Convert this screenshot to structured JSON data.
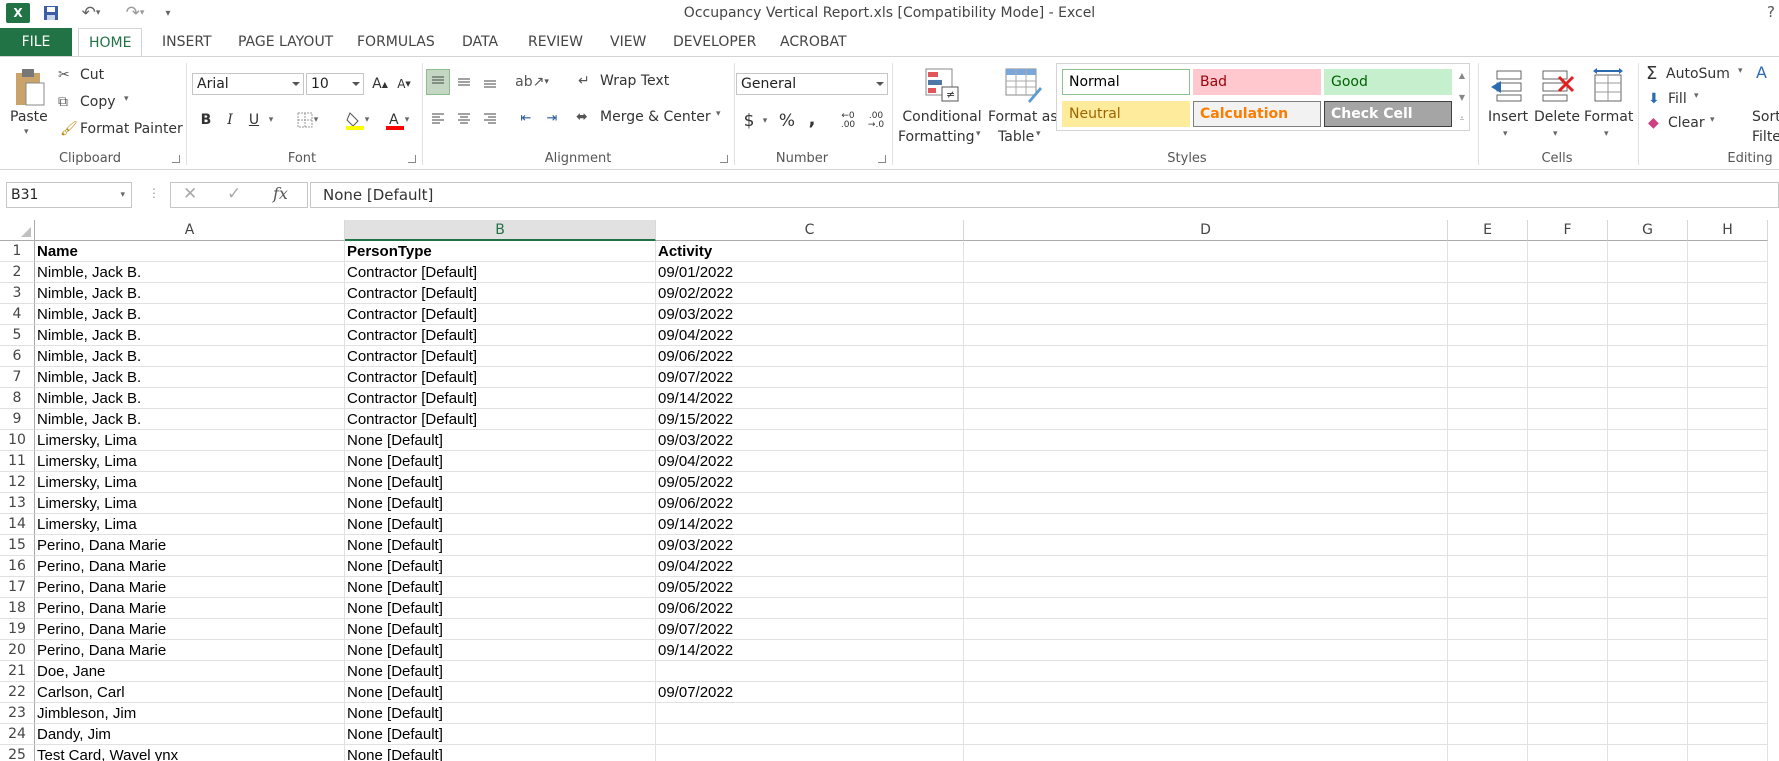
{
  "window": {
    "title": "Occupancy Vertical Report.xls  [Compatibility Mode] - Excel",
    "help": "?"
  },
  "tabs": [
    "FILE",
    "HOME",
    "INSERT",
    "PAGE LAYOUT",
    "FORMULAS",
    "DATA",
    "REVIEW",
    "VIEW",
    "DEVELOPER",
    "ACROBAT"
  ],
  "active_tab": "HOME",
  "ribbon": {
    "clipboard": {
      "paste": "Paste",
      "cut": "Cut",
      "copy": "Copy",
      "format_painter": "Format Painter",
      "label": "Clipboard"
    },
    "font": {
      "name": "Arial",
      "size": "10",
      "bold": "B",
      "italic": "I",
      "underline": "U",
      "label": "Font"
    },
    "alignment": {
      "wrap_text": "Wrap Text",
      "merge_center": "Merge & Center",
      "label": "Alignment"
    },
    "number": {
      "format": "General",
      "currency": "$",
      "percent": "%",
      "comma": ",",
      "label": "Number"
    },
    "styles": {
      "conditional": "Conditional",
      "conditional2": "Formatting",
      "format_as": "Format as",
      "format_as2": "Table",
      "label": "Styles",
      "cells": [
        {
          "name": "Normal",
          "bg": "#ffffff",
          "fg": "#000000",
          "border": "#8fc08f"
        },
        {
          "name": "Bad",
          "bg": "#ffc7ce",
          "fg": "#9c0006",
          "border": "#ffc7ce"
        },
        {
          "name": "Good",
          "bg": "#c6efce",
          "fg": "#006100",
          "border": "#c6efce"
        },
        {
          "name": "Neutral",
          "bg": "#ffeb9c",
          "fg": "#9c6500",
          "border": "#ffeb9c"
        },
        {
          "name": "Calculation",
          "bg": "#f2f2f2",
          "fg": "#fa7d00",
          "border": "#7f7f7f"
        },
        {
          "name": "Check Cell",
          "bg": "#a5a5a5",
          "fg": "#ffffff",
          "border": "#3f3f3f"
        }
      ]
    },
    "cells": {
      "insert": "Insert",
      "delete": "Delete",
      "format": "Format",
      "label": "Cells"
    },
    "editing": {
      "autosum": "AutoSum",
      "fill": "Fill",
      "clear": "Clear",
      "sort": "Sort",
      "filter": "Filte",
      "label": "Editing"
    }
  },
  "formula_bar": {
    "name_box": "B31",
    "formula": "None [Default]",
    "fx": "fx"
  },
  "columns": [
    "A",
    "B",
    "C",
    "D",
    "E",
    "F",
    "G",
    "H"
  ],
  "selected_column": "B",
  "rows": [
    [
      "1",
      "Name",
      "PersonType",
      "Activity"
    ],
    [
      "2",
      "Nimble, Jack B.",
      "Contractor [Default]",
      "09/01/2022"
    ],
    [
      "3",
      "Nimble, Jack B.",
      "Contractor [Default]",
      "09/02/2022"
    ],
    [
      "4",
      "Nimble, Jack B.",
      "Contractor [Default]",
      "09/03/2022"
    ],
    [
      "5",
      "Nimble, Jack B.",
      "Contractor [Default]",
      "09/04/2022"
    ],
    [
      "6",
      "Nimble, Jack B.",
      "Contractor [Default]",
      "09/06/2022"
    ],
    [
      "7",
      "Nimble, Jack B.",
      "Contractor [Default]",
      "09/07/2022"
    ],
    [
      "8",
      "Nimble, Jack B.",
      "Contractor [Default]",
      "09/14/2022"
    ],
    [
      "9",
      "Nimble, Jack B.",
      "Contractor [Default]",
      "09/15/2022"
    ],
    [
      "10",
      "Limersky, Lima",
      "None [Default]",
      "09/03/2022"
    ],
    [
      "11",
      "Limersky, Lima",
      "None [Default]",
      "09/04/2022"
    ],
    [
      "12",
      "Limersky, Lima",
      "None [Default]",
      "09/05/2022"
    ],
    [
      "13",
      "Limersky, Lima",
      "None [Default]",
      "09/06/2022"
    ],
    [
      "14",
      "Limersky, Lima",
      "None [Default]",
      "09/14/2022"
    ],
    [
      "15",
      "Perino, Dana Marie",
      "None [Default]",
      "09/03/2022"
    ],
    [
      "16",
      "Perino, Dana Marie",
      "None [Default]",
      "09/04/2022"
    ],
    [
      "17",
      "Perino, Dana Marie",
      "None [Default]",
      "09/05/2022"
    ],
    [
      "18",
      "Perino, Dana Marie",
      "None [Default]",
      "09/06/2022"
    ],
    [
      "19",
      "Perino, Dana Marie",
      "None [Default]",
      "09/07/2022"
    ],
    [
      "20",
      "Perino, Dana Marie",
      "None [Default]",
      "09/14/2022"
    ],
    [
      "21",
      "Doe, Jane",
      "None [Default]",
      ""
    ],
    [
      "22",
      "Carlson, Carl",
      "None [Default]",
      "09/07/2022"
    ],
    [
      "23",
      "Jimbleson, Jim",
      "None [Default]",
      ""
    ],
    [
      "24",
      "Dandy, Jim",
      "None [Default]",
      ""
    ],
    [
      "25",
      "Test Card, Wavel ynx",
      "None [Default]",
      ""
    ]
  ]
}
